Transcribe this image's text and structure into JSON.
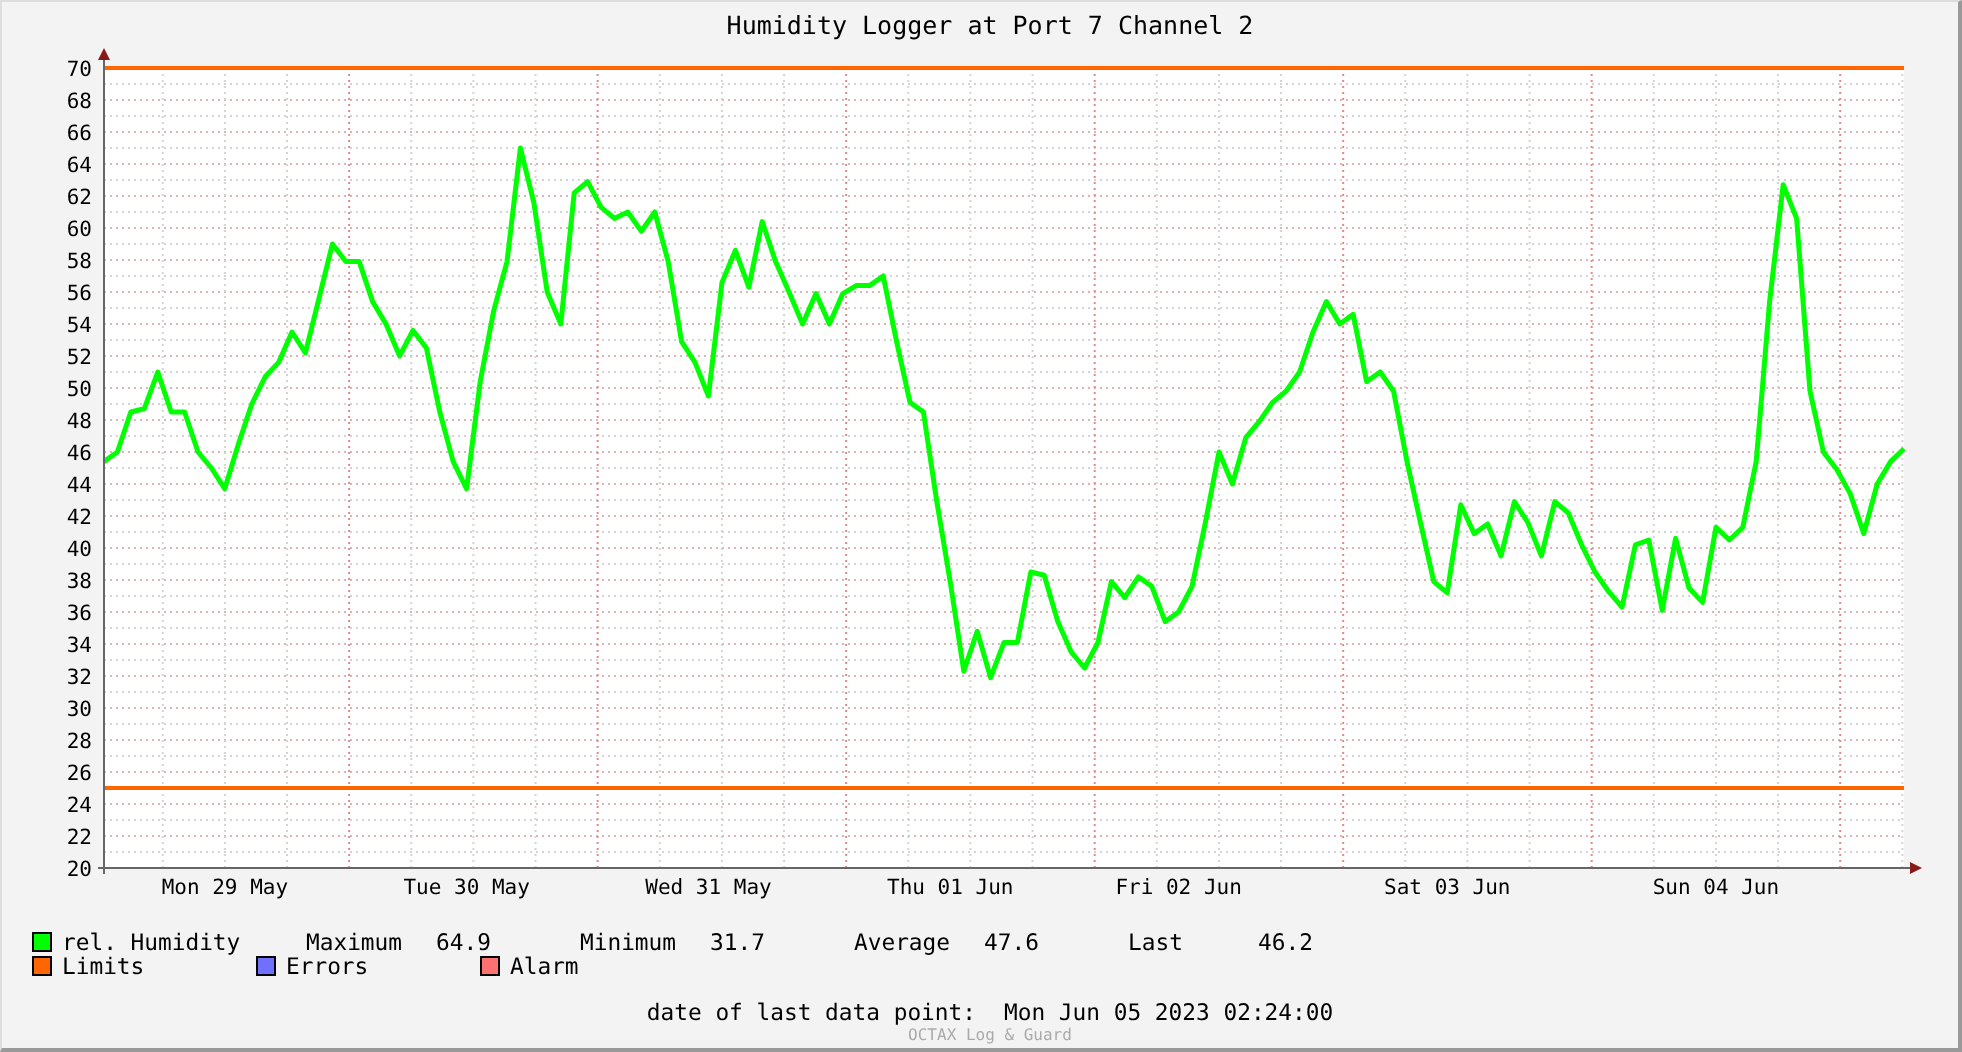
{
  "title": "Humidity Logger at Port 7 Channel 2",
  "chart_data": {
    "type": "line",
    "ylim": [
      20,
      70
    ],
    "categories": [
      null,
      null,
      null,
      null,
      null,
      null,
      null,
      null,
      null,
      "Mon 29 May",
      null,
      null,
      null,
      null,
      null,
      null,
      null,
      null,
      null,
      null,
      null,
      null,
      null,
      null,
      null,
      null,
      null,
      "Tue 30 May",
      null,
      null,
      null,
      null,
      null,
      null,
      null,
      null,
      null,
      null,
      null,
      null,
      null,
      null,
      null,
      null,
      null,
      "Wed 31 May",
      null,
      null,
      null,
      null,
      null,
      null,
      null,
      null,
      null,
      null,
      null,
      null,
      null,
      null,
      null,
      null,
      null,
      "Thu 01 Jun",
      null,
      null,
      null,
      null,
      null,
      null,
      null,
      null,
      null,
      null,
      null,
      null,
      null,
      null,
      null,
      null,
      "Fri 02 Jun",
      null,
      null,
      null,
      null,
      null,
      null,
      null,
      null,
      null,
      null,
      null,
      null,
      null,
      null,
      null,
      null,
      null,
      null,
      null,
      "Sat 03 Jun",
      null,
      null,
      null,
      null,
      null,
      null,
      null,
      null,
      null,
      null,
      null,
      null,
      null,
      null,
      null,
      null,
      null,
      null,
      null,
      "Sun 04 Jun",
      null,
      null,
      null,
      null,
      null,
      null,
      null,
      null,
      null,
      null,
      null,
      null,
      null,
      null
    ],
    "yticks": [
      20,
      22,
      24,
      26,
      28,
      30,
      32,
      34,
      36,
      38,
      40,
      42,
      44,
      46,
      48,
      50,
      52,
      54,
      56,
      58,
      60,
      62,
      64,
      66,
      68,
      70
    ],
    "series": [
      {
        "name": "rel. Humidity",
        "color": "#00ff00",
        "values": [
          45.4,
          46,
          48.5,
          48.7,
          51,
          48.5,
          48.5,
          46,
          45,
          43.7,
          46.5,
          49,
          50.7,
          51.6,
          53.5,
          52.2,
          55.6,
          59,
          57.9,
          57.9,
          55.4,
          54,
          52,
          53.6,
          52.5,
          48.5,
          45.4,
          43.7,
          50.4,
          54.8,
          57.9,
          65,
          61.6,
          56,
          54,
          62.2,
          62.9,
          61.3,
          60.6,
          61,
          59.8,
          61,
          57.9,
          52.9,
          51.6,
          49.5,
          56.6,
          58.6,
          56.3,
          60.4,
          57.9,
          56,
          54,
          55.9,
          54,
          55.9,
          56.4,
          56.4,
          57,
          52.9,
          49.1,
          48.5,
          42.9,
          37.9,
          32.3,
          34.8,
          31.9,
          34.1,
          34.1,
          38.5,
          38.3,
          35.4,
          33.5,
          32.5,
          34.1,
          37.9,
          36.9,
          38.2,
          37.6,
          35.4,
          36,
          37.6,
          41.6,
          46,
          44,
          46.9,
          47.9,
          49.1,
          49.8,
          51,
          53.5,
          55.4,
          54,
          54.6,
          50.4,
          51,
          49.8,
          45.4,
          41.6,
          37.9,
          37.2,
          42.7,
          40.9,
          41.5,
          39.5,
          42.9,
          41.6,
          39.5,
          42.9,
          42.2,
          40.2,
          38.5,
          37.3,
          36.3,
          40.2,
          40.5,
          36.1,
          40.6,
          37.5,
          36.6,
          41.3,
          40.5,
          41.3,
          45.4,
          55.4,
          62.7,
          60.6,
          49.8,
          46,
          44.9,
          43.4,
          40.9,
          44,
          45.4,
          46.2
        ]
      }
    ],
    "grid": true,
    "ref_lines": [
      {
        "axis": "y",
        "value": 70
      },
      {
        "axis": "y",
        "value": 25
      }
    ]
  },
  "legend": [
    {
      "label": "Limits",
      "color": "#ff6600"
    },
    {
      "label": "Errors",
      "color": "#7070ff"
    },
    {
      "label": "Alarm",
      "color": "#ff7070"
    }
  ],
  "stats": [
    {
      "label": "Maximum",
      "value": "64.9"
    },
    {
      "label": "Minimum",
      "value": "31.7"
    },
    {
      "label": "Average",
      "value": "47.6"
    },
    {
      "label": "Last",
      "value": "46.2"
    }
  ],
  "last_data": {
    "label": "date of last data point:",
    "value": "Mon Jun 05 2023 02:24:00"
  },
  "credit": "OCTAX Log & Guard"
}
